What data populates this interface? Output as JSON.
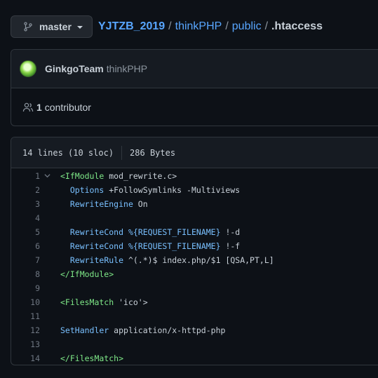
{
  "branch": {
    "label": "master",
    "icon": "git-branch-icon"
  },
  "breadcrumb": {
    "root": "YJTZB_2019",
    "parts": [
      "thinkPHP",
      "public"
    ],
    "separator": "/",
    "file": ".htaccess"
  },
  "commit": {
    "author": "GinkgoTeam",
    "repo": "thinkPHP",
    "contributors_count": "1",
    "contributors_label": "contributor"
  },
  "file": {
    "lines_info": "14 lines (10 sloc)",
    "size": "286 Bytes"
  },
  "code": [
    {
      "n": "1",
      "fold": true,
      "tokens": [
        [
          "tag",
          "<IfModule"
        ],
        [
          "plain",
          " mod_rewrite.c>"
        ]
      ]
    },
    {
      "n": "2",
      "tokens": [
        [
          "plain",
          "  "
        ],
        [
          "kw",
          "Options"
        ],
        [
          "plain",
          " +FollowSymlinks -Multiviews"
        ]
      ]
    },
    {
      "n": "3",
      "tokens": [
        [
          "plain",
          "  "
        ],
        [
          "kw",
          "RewriteEngine"
        ],
        [
          "plain",
          " On"
        ]
      ]
    },
    {
      "n": "4",
      "tokens": []
    },
    {
      "n": "5",
      "tokens": [
        [
          "plain",
          "  "
        ],
        [
          "kw",
          "RewriteCond"
        ],
        [
          "plain",
          " "
        ],
        [
          "kw",
          "%{REQUEST_FILENAME}"
        ],
        [
          "plain",
          " !-d"
        ]
      ]
    },
    {
      "n": "6",
      "tokens": [
        [
          "plain",
          "  "
        ],
        [
          "kw",
          "RewriteCond"
        ],
        [
          "plain",
          " "
        ],
        [
          "kw",
          "%{REQUEST_FILENAME}"
        ],
        [
          "plain",
          " !-f"
        ]
      ]
    },
    {
      "n": "7",
      "tokens": [
        [
          "plain",
          "  "
        ],
        [
          "kw",
          "RewriteRule"
        ],
        [
          "plain",
          " ^(.*)$ index.php/$1 [QSA,PT,L]"
        ]
      ]
    },
    {
      "n": "8",
      "tokens": [
        [
          "tag",
          "</IfModule>"
        ]
      ]
    },
    {
      "n": "9",
      "tokens": []
    },
    {
      "n": "10",
      "tokens": [
        [
          "tag",
          "<FilesMatch"
        ],
        [
          "plain",
          " 'ico'>"
        ]
      ]
    },
    {
      "n": "11",
      "tokens": []
    },
    {
      "n": "12",
      "tokens": [
        [
          "kw",
          "SetHandler"
        ],
        [
          "plain",
          " application/x-httpd-php"
        ]
      ]
    },
    {
      "n": "13",
      "tokens": []
    },
    {
      "n": "14",
      "tokens": [
        [
          "tag",
          "</FilesMatch>"
        ]
      ]
    }
  ]
}
